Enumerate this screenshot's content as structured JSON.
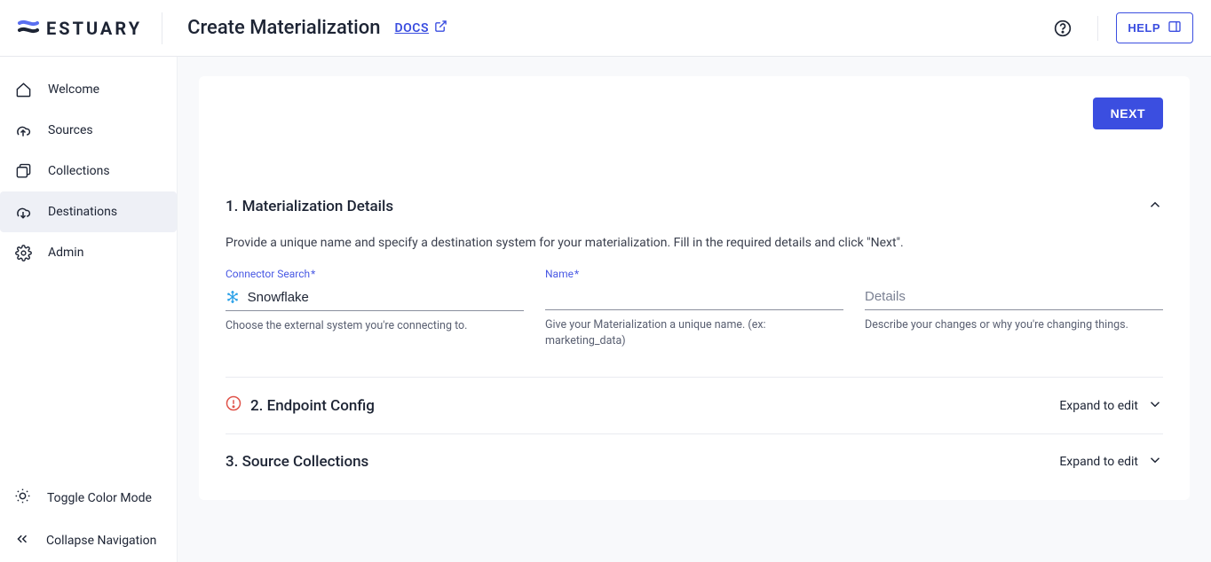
{
  "brand": {
    "name": "ESTUARY"
  },
  "header": {
    "title": "Create Materialization",
    "docs_label": "DOCS",
    "help_button": "HELP"
  },
  "sidebar": {
    "items": [
      {
        "label": "Welcome"
      },
      {
        "label": "Sources"
      },
      {
        "label": "Collections"
      },
      {
        "label": "Destinations"
      },
      {
        "label": "Admin"
      }
    ],
    "footer": {
      "toggle_mode": "Toggle Color Mode",
      "collapse": "Collapse Navigation"
    }
  },
  "actions": {
    "next": "NEXT"
  },
  "sections": {
    "details": {
      "title": "1. Materialization Details",
      "description": "Provide a unique name and specify a destination system for your materialization. Fill in the required details and click \"Next\".",
      "fields": {
        "connector": {
          "label": "Connector Search",
          "value": "Snowflake",
          "help": "Choose the external system you're connecting to."
        },
        "name": {
          "label": "Name",
          "value": "",
          "help": "Give your Materialization a unique name. (ex: marketing_data)"
        },
        "details_field": {
          "placeholder": "Details",
          "help": "Describe your changes or why you're changing things."
        }
      }
    },
    "endpoint": {
      "title": "2. Endpoint Config",
      "expand_label": "Expand to edit"
    },
    "source": {
      "title": "3. Source Collections",
      "expand_label": "Expand to edit"
    }
  }
}
